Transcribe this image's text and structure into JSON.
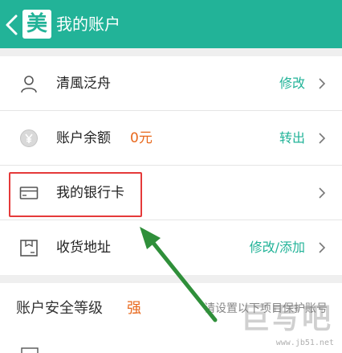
{
  "header": {
    "title": "我的账户",
    "logo_char": "美"
  },
  "account_items": [
    {
      "label": "清風泛舟",
      "value": "",
      "action": "修改",
      "icon": "user-icon"
    },
    {
      "label": "账户余额",
      "value": "0元",
      "action": "转出",
      "icon": "yuan-coin-icon"
    },
    {
      "label": "我的银行卡",
      "value": "",
      "action": "",
      "icon": "bank-card-icon"
    },
    {
      "label": "收货地址",
      "value": "",
      "action": "修改/添加",
      "icon": "package-icon"
    }
  ],
  "security": {
    "title": "账户安全等级",
    "level": "强",
    "hint": "请设置以下项目保护账号"
  },
  "watermark": {
    "text": "巨写吧",
    "url": "www.jb51.net"
  },
  "colors": {
    "brand": "#22b398",
    "accent": "#e8681c",
    "highlight": "#e53a3a",
    "arrow": "#2f8f3a"
  }
}
